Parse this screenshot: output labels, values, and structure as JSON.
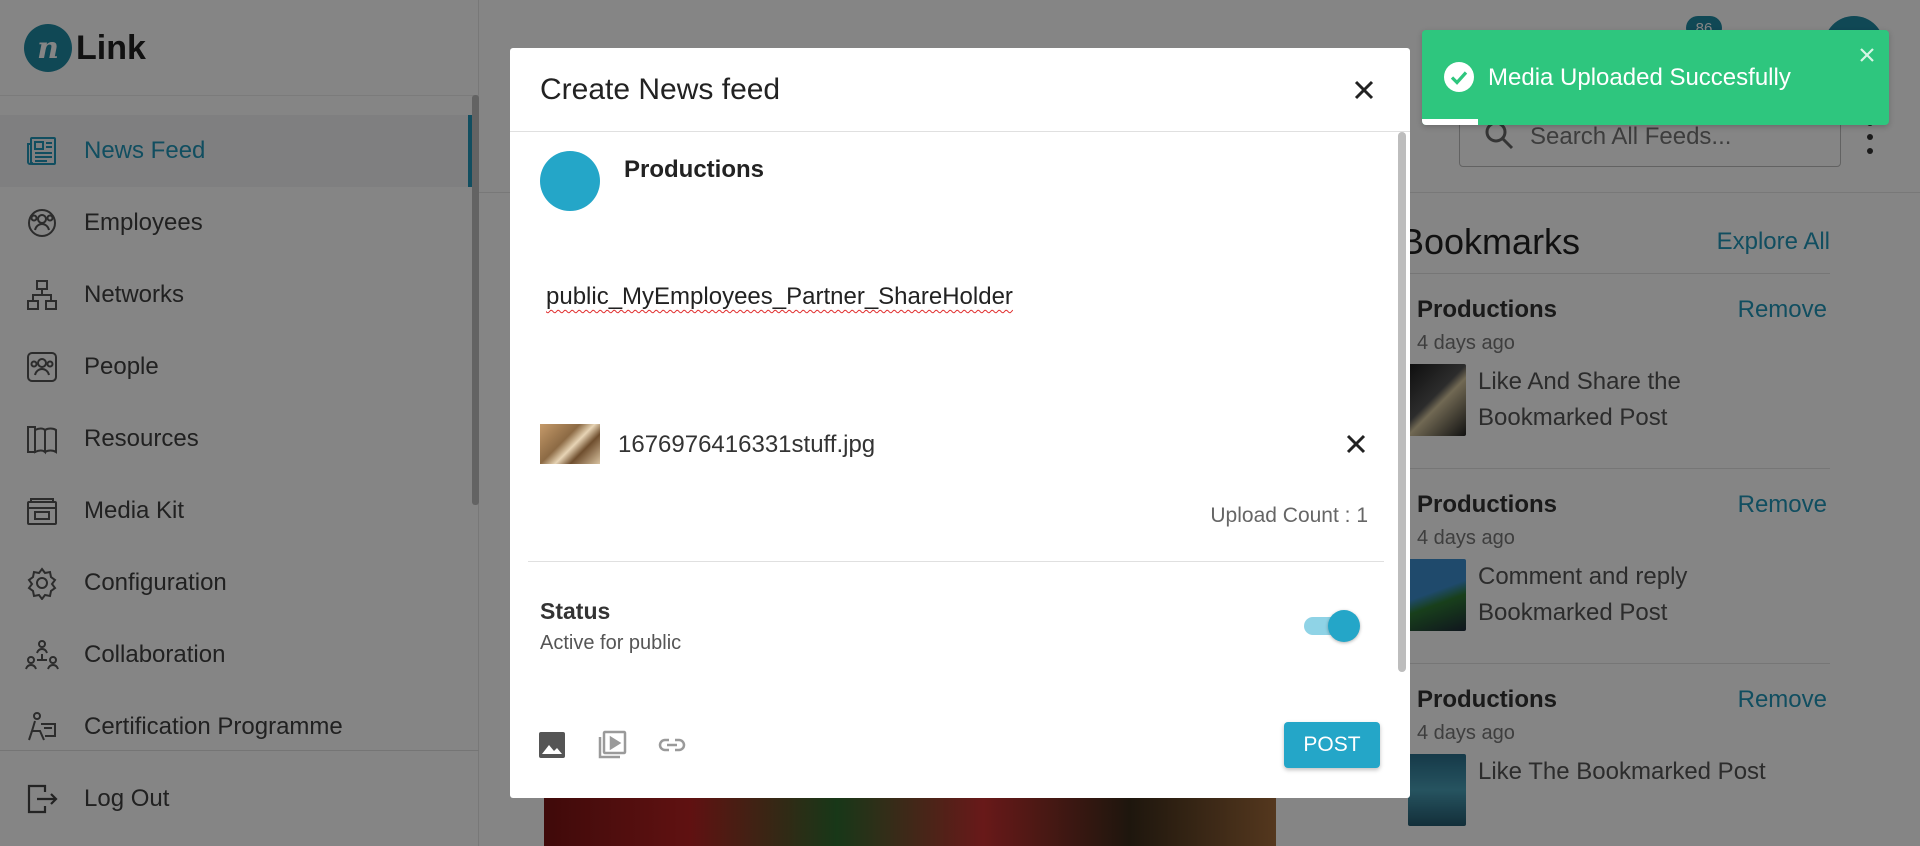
{
  "app": {
    "logo_letter": "n",
    "logo_text": "Link"
  },
  "sidebar": {
    "items": [
      {
        "label": "News Feed",
        "icon": "newspaper-icon",
        "active": true
      },
      {
        "label": "Employees",
        "icon": "employees-icon",
        "active": false
      },
      {
        "label": "Networks",
        "icon": "network-icon",
        "active": false
      },
      {
        "label": "People",
        "icon": "people-icon",
        "active": false
      },
      {
        "label": "Resources",
        "icon": "book-icon",
        "active": false
      },
      {
        "label": "Media Kit",
        "icon": "media-kit-icon",
        "active": false
      },
      {
        "label": "Configuration",
        "icon": "gear-icon",
        "active": false
      },
      {
        "label": "Collaboration",
        "icon": "collaboration-icon",
        "active": false
      },
      {
        "label": "Certification Programme",
        "icon": "certification-icon",
        "active": false
      }
    ],
    "logout_label": "Log Out"
  },
  "header": {
    "notification_count": "86",
    "search_placeholder": "Search All Feeds..."
  },
  "bookmarks": {
    "title": "Bookmarks",
    "explore_label": "Explore All",
    "items": [
      {
        "name": "Productions",
        "time": "4 days ago",
        "text": "Like And Share the Bookmarked Post",
        "remove_label": "Remove"
      },
      {
        "name": "Productions",
        "time": "4 days ago",
        "text": "Comment and reply Bookmarked Post",
        "remove_label": "Remove"
      },
      {
        "name": "Productions",
        "time": "4 days ago",
        "text": "Like The Bookmarked Post",
        "remove_label": "Remove"
      }
    ]
  },
  "modal": {
    "title": "Create News feed",
    "author_name": "Productions",
    "post_text": "public_MyEmployees_Partner_ShareHolder",
    "attachment": {
      "file_name": "1676976416331stuff.jpg"
    },
    "upload_count": "Upload Count : 1",
    "status": {
      "label": "Status",
      "description": "Active for public",
      "enabled": true
    },
    "toolbar": [
      "image-icon",
      "video-icon",
      "link-icon"
    ],
    "post_label": "POST"
  },
  "toast": {
    "message": "Media Uploaded Succesfully",
    "progress": 0.12
  },
  "colors": {
    "brand": "#1f8aa3",
    "accent": "#24a6c8",
    "link": "#2196b8",
    "toast_success": "#2ec67e",
    "spell_error": "#e02b2b"
  }
}
